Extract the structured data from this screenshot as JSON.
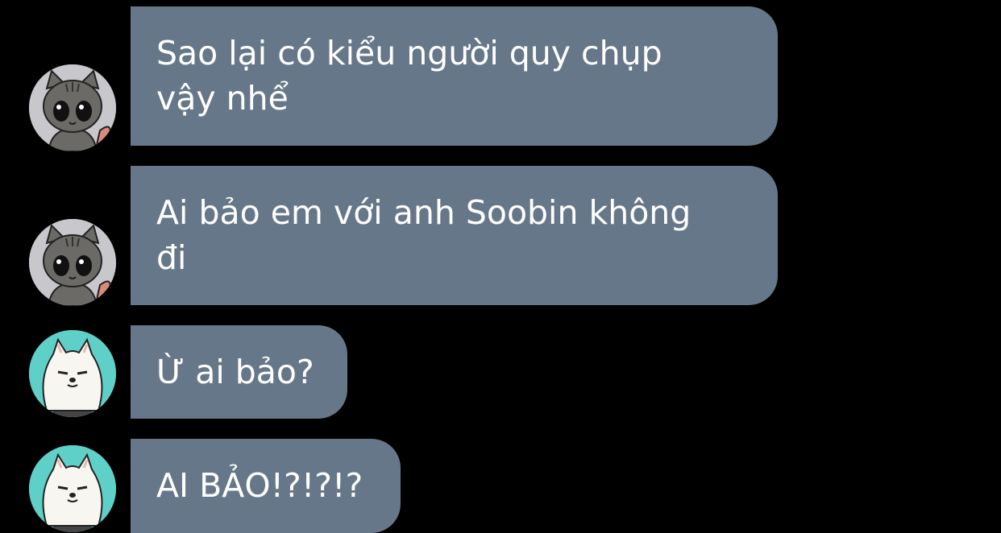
{
  "colors": {
    "background": "#000000",
    "bubble": "#667789",
    "text": "#ffffff",
    "cat_avatar_bg": "#c7c7cc",
    "dog_avatar_bg": "#5fd0c8"
  },
  "messages": [
    {
      "avatar": "gray-cat-avatar",
      "lines": [
        "Sao lại có kiểu người quy chụp",
        "vậy nhể"
      ]
    },
    {
      "avatar": "gray-cat-avatar",
      "lines": [
        "Ai bảo em với anh Soobin không",
        "đi"
      ]
    },
    {
      "avatar": "white-dog-avatar",
      "lines": [
        "Ừ ai bảo?"
      ]
    },
    {
      "avatar": "white-dog-avatar",
      "lines": [
        "AI BẢO!?!?!?"
      ]
    }
  ]
}
